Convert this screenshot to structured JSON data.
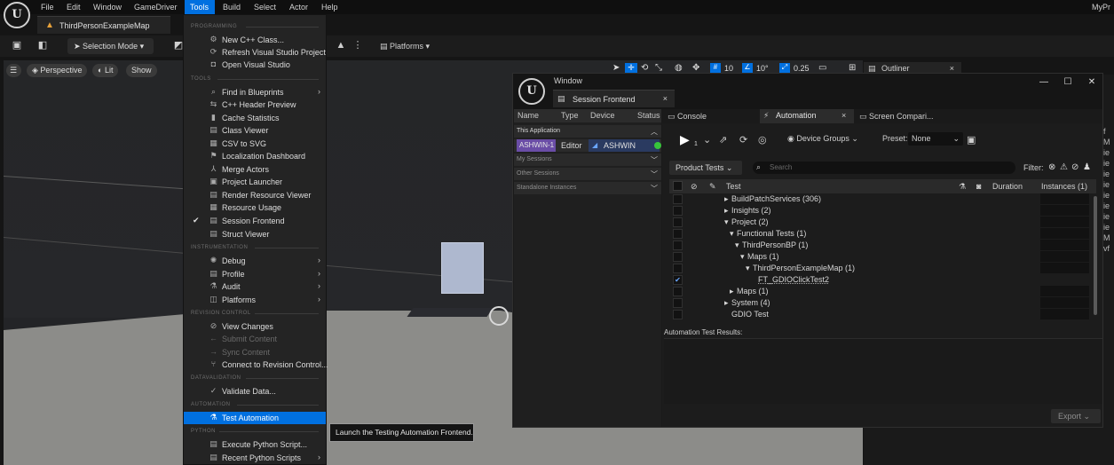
{
  "app": {
    "menus": [
      "File",
      "Edit",
      "Window",
      "GameDriver",
      "Tools",
      "Build",
      "Select",
      "Actor",
      "Help"
    ],
    "active_menu": "Tools",
    "user_label": "MyPr",
    "level_tab": "ThirdPersonExampleMap"
  },
  "toolbar": {
    "selection_mode": "Selection Mode",
    "platforms": "Platforms"
  },
  "viewport": {
    "perspective": "Perspective",
    "lit": "Lit",
    "show": "Show",
    "readouts": [
      "10",
      "10°",
      "0.25"
    ]
  },
  "tools_menu": {
    "sections": {
      "programming": "PROGRAMMING",
      "tools": "TOOLS",
      "instrumentation": "INSTRUMENTATION",
      "revision_control": "REVISION CONTROL",
      "datavalidation": "DATAVALIDATION",
      "automation": "AUTOMATION",
      "python": "PYTHON"
    },
    "items": {
      "new_cpp_class": "New C++ Class...",
      "refresh_vs": "Refresh Visual Studio Project",
      "open_vs": "Open Visual Studio",
      "find_in_blueprints": "Find in Blueprints",
      "cpp_header_preview": "C++ Header Preview",
      "cache_statistics": "Cache Statistics",
      "class_viewer": "Class Viewer",
      "csv_to_svg": "CSV to SVG",
      "localization_dashboard": "Localization Dashboard",
      "merge_actors": "Merge Actors",
      "project_launcher": "Project Launcher",
      "render_resource_viewer": "Render Resource Viewer",
      "resource_usage": "Resource Usage",
      "session_frontend": "Session Frontend",
      "struct_viewer": "Struct Viewer",
      "debug": "Debug",
      "profile": "Profile",
      "audit": "Audit",
      "platforms": "Platforms",
      "view_changes": "View Changes",
      "submit_content": "Submit Content",
      "sync_content": "Sync Content",
      "connect_revision_control": "Connect to Revision Control...",
      "validate_data": "Validate Data...",
      "test_automation": "Test Automation",
      "execute_python": "Execute Python Script...",
      "recent_python": "Recent Python Scripts"
    },
    "tooltip": "Launch the Testing Automation Frontend."
  },
  "outliner": {
    "tab": "Outliner"
  },
  "right_edge": [
    "f",
    "M",
    "ie",
    "ie",
    "ie",
    "ie",
    "ie",
    "ie",
    "ie",
    "ie",
    "M",
    "vf"
  ],
  "session_frontend": {
    "window_menu": "Window",
    "tab_label": "Session Frontend",
    "sessions_columns": [
      "Name",
      "Type",
      "Device",
      "Status"
    ],
    "groups": {
      "this_application": "This Application",
      "my_sessions": "My Sessions",
      "other_sessions": "Other Sessions",
      "standalone": "Standalone Instances"
    },
    "session_row": {
      "instance": "ASHWIN-1",
      "type": "Editor",
      "device": "ASHWIN"
    },
    "tabs": {
      "console": "Console",
      "automation": "Automation",
      "screen_comparison": "Screen Compari..."
    },
    "automation": {
      "play_count": "1",
      "device_groups": "Device Groups",
      "preset_label": "Preset:",
      "preset_value": "None",
      "product_tests": "Product Tests",
      "search_placeholder": "Search",
      "filter_label": "Filter:",
      "columns": {
        "test": "Test",
        "duration": "Duration",
        "instances": "Instances (1)"
      },
      "tests": [
        {
          "name": "BuildPatchServices (306)",
          "checked": false
        },
        {
          "name": "Insights (2)",
          "checked": false
        },
        {
          "name": "Project (2)",
          "checked": false
        },
        {
          "name": "Functional Tests (1)",
          "checked": false
        },
        {
          "name": "ThirdPersonBP (1)",
          "checked": false
        },
        {
          "name": "Maps (1)",
          "checked": false
        },
        {
          "name": "ThirdPersonExampleMap (1)",
          "checked": false
        },
        {
          "name": "FT_GDIOClickTest2",
          "checked": true
        },
        {
          "name": "Maps (1)",
          "checked": false
        },
        {
          "name": "System (4)",
          "checked": false
        },
        {
          "name": "GDIO Test",
          "checked": false
        }
      ],
      "results_label": "Automation Test Results:",
      "export": "Export"
    }
  }
}
